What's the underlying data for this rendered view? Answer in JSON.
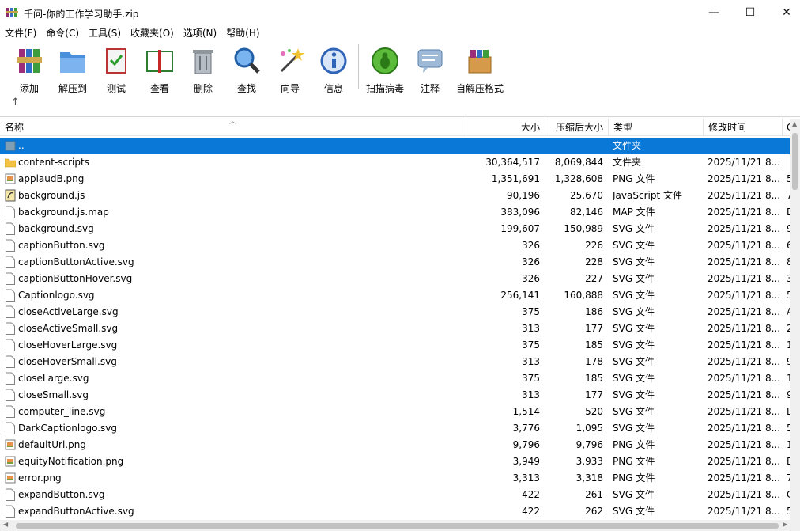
{
  "window": {
    "title": "千问-你的工作学习助手.zip",
    "controls": {
      "minimize": "—",
      "maximize": "☐",
      "close": "✕"
    }
  },
  "menu": [
    "文件(F)",
    "命令(C)",
    "工具(S)",
    "收藏夹(O)",
    "选项(N)",
    "帮助(H)"
  ],
  "toolbar": [
    {
      "label": "添加",
      "icon": "add-archive-icon"
    },
    {
      "label": "解压到",
      "icon": "extract-to-icon"
    },
    {
      "label": "测试",
      "icon": "test-icon"
    },
    {
      "label": "查看",
      "icon": "view-icon"
    },
    {
      "label": "删除",
      "icon": "delete-icon"
    },
    {
      "label": "查找",
      "icon": "find-icon"
    },
    {
      "label": "向导",
      "icon": "wizard-icon"
    },
    {
      "label": "信息",
      "icon": "info-icon"
    },
    {
      "label": "扫描病毒",
      "icon": "virus-scan-icon"
    },
    {
      "label": "注释",
      "icon": "comment-icon"
    },
    {
      "label": "自解压格式",
      "icon": "sfx-icon"
    }
  ],
  "up_arrow": "↑",
  "columns": {
    "name": "名称",
    "size": "大小",
    "packed": "压缩后大小",
    "type": "类型",
    "modified": "修改时间",
    "extra": "C"
  },
  "colors": {
    "selection": "#0a78d7",
    "folder": "#f3c242"
  },
  "files": [
    {
      "name": "..",
      "size": "",
      "packed": "",
      "type": "文件夹",
      "modified": "",
      "extra": "",
      "icon": "parent-folder-icon",
      "selected": true
    },
    {
      "name": "content-scripts",
      "size": "30,364,517",
      "packed": "8,069,844",
      "type": "文件夹",
      "modified": "2025/11/21 8...",
      "extra": "",
      "icon": "folder-icon"
    },
    {
      "name": "applaudB.png",
      "size": "1,351,691",
      "packed": "1,328,608",
      "type": "PNG 文件",
      "modified": "2025/11/21 8...",
      "extra": "5",
      "icon": "image-file-icon"
    },
    {
      "name": "background.js",
      "size": "90,196",
      "packed": "25,670",
      "type": "JavaScript 文件",
      "modified": "2025/11/21 8...",
      "extra": "7",
      "icon": "script-file-icon"
    },
    {
      "name": "background.js.map",
      "size": "383,096",
      "packed": "82,146",
      "type": "MAP 文件",
      "modified": "2025/11/21 8...",
      "extra": "D",
      "icon": "file-icon"
    },
    {
      "name": "background.svg",
      "size": "199,607",
      "packed": "150,989",
      "type": "SVG 文件",
      "modified": "2025/11/21 8...",
      "extra": "9",
      "icon": "file-icon"
    },
    {
      "name": "captionButton.svg",
      "size": "326",
      "packed": "226",
      "type": "SVG 文件",
      "modified": "2025/11/21 8...",
      "extra": "6",
      "icon": "file-icon"
    },
    {
      "name": "captionButtonActive.svg",
      "size": "326",
      "packed": "228",
      "type": "SVG 文件",
      "modified": "2025/11/21 8...",
      "extra": "8",
      "icon": "file-icon"
    },
    {
      "name": "captionButtonHover.svg",
      "size": "326",
      "packed": "227",
      "type": "SVG 文件",
      "modified": "2025/11/21 8...",
      "extra": "3",
      "icon": "file-icon"
    },
    {
      "name": "Captionlogo.svg",
      "size": "256,141",
      "packed": "160,888",
      "type": "SVG 文件",
      "modified": "2025/11/21 8...",
      "extra": "5",
      "icon": "file-icon"
    },
    {
      "name": "closeActiveLarge.svg",
      "size": "375",
      "packed": "186",
      "type": "SVG 文件",
      "modified": "2025/11/21 8...",
      "extra": "A",
      "icon": "file-icon"
    },
    {
      "name": "closeActiveSmall.svg",
      "size": "313",
      "packed": "177",
      "type": "SVG 文件",
      "modified": "2025/11/21 8...",
      "extra": "2",
      "icon": "file-icon"
    },
    {
      "name": "closeHoverLarge.svg",
      "size": "375",
      "packed": "185",
      "type": "SVG 文件",
      "modified": "2025/11/21 8...",
      "extra": "1",
      "icon": "file-icon"
    },
    {
      "name": "closeHoverSmall.svg",
      "size": "313",
      "packed": "178",
      "type": "SVG 文件",
      "modified": "2025/11/21 8...",
      "extra": "9",
      "icon": "file-icon"
    },
    {
      "name": "closeLarge.svg",
      "size": "375",
      "packed": "185",
      "type": "SVG 文件",
      "modified": "2025/11/21 8...",
      "extra": "1",
      "icon": "file-icon"
    },
    {
      "name": "closeSmall.svg",
      "size": "313",
      "packed": "177",
      "type": "SVG 文件",
      "modified": "2025/11/21 8...",
      "extra": "9",
      "icon": "file-icon"
    },
    {
      "name": "computer_line.svg",
      "size": "1,514",
      "packed": "520",
      "type": "SVG 文件",
      "modified": "2025/11/21 8...",
      "extra": "D",
      "icon": "file-icon"
    },
    {
      "name": "DarkCaptionlogo.svg",
      "size": "3,776",
      "packed": "1,095",
      "type": "SVG 文件",
      "modified": "2025/11/21 8...",
      "extra": "5",
      "icon": "file-icon"
    },
    {
      "name": "defaultUrl.png",
      "size": "9,796",
      "packed": "9,796",
      "type": "PNG 文件",
      "modified": "2025/11/21 8...",
      "extra": "1",
      "icon": "image-file-icon"
    },
    {
      "name": "equityNotification.png",
      "size": "3,949",
      "packed": "3,933",
      "type": "PNG 文件",
      "modified": "2025/11/21 8...",
      "extra": "D",
      "icon": "image-file-icon"
    },
    {
      "name": "error.png",
      "size": "3,313",
      "packed": "3,318",
      "type": "PNG 文件",
      "modified": "2025/11/21 8...",
      "extra": "7",
      "icon": "image-file-icon"
    },
    {
      "name": "expandButton.svg",
      "size": "422",
      "packed": "261",
      "type": "SVG 文件",
      "modified": "2025/11/21 8...",
      "extra": "C",
      "icon": "file-icon"
    },
    {
      "name": "expandButtonActive.svg",
      "size": "422",
      "packed": "262",
      "type": "SVG 文件",
      "modified": "2025/11/21 8...",
      "extra": "5",
      "icon": "file-icon"
    }
  ]
}
